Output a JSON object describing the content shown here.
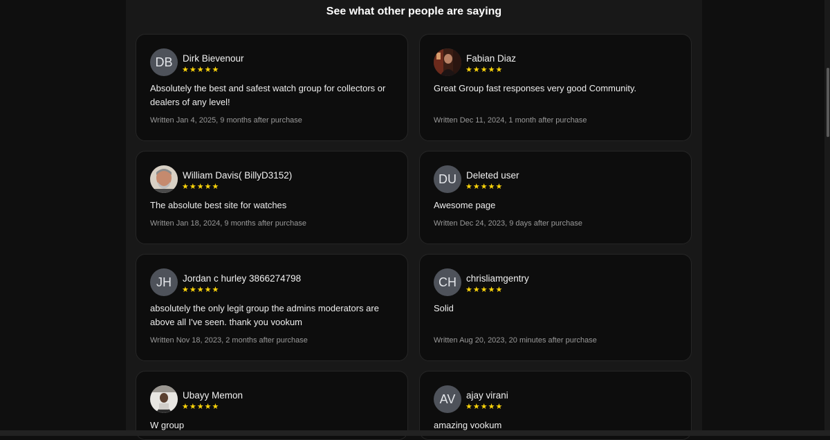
{
  "section": {
    "title": "See what other people are saying"
  },
  "colors": {
    "star": "#ffd60a",
    "avatar_bg": "#4e525a",
    "card_bg": "#0d0d0d",
    "page_bg": "#181818"
  },
  "reviews": [
    {
      "initials": "DB",
      "name": "Dirk Bievenour",
      "rating": 5,
      "text": "Absolutely the best and safest watch group for collectors or dealers of any level!",
      "meta": "Written Jan 4, 2025, 9 months after purchase"
    },
    {
      "initials": "",
      "name": "Fabian Diaz",
      "rating": 5,
      "text": "Great Group fast responses very good Community.",
      "meta": "Written Dec 11, 2024, 1 month after purchase"
    },
    {
      "initials": "",
      "name": "William Davis( BillyD3152)",
      "rating": 5,
      "text": "The absolute best site for watches",
      "meta": "Written Jan 18, 2024, 9 months after purchase"
    },
    {
      "initials": "DU",
      "name": "Deleted user",
      "rating": 5,
      "text": "Awesome page",
      "meta": "Written Dec 24, 2023, 9 days after purchase"
    },
    {
      "initials": "JH",
      "name": "Jordan c hurley 3866274798",
      "rating": 5,
      "text": "absolutely the only legit group the admins moderators are above all I've seen. thank you vookum",
      "meta": "Written Nov 18, 2023, 2 months after purchase"
    },
    {
      "initials": "CH",
      "name": "chrisliamgentry",
      "rating": 5,
      "text": "Solid",
      "meta": "Written Aug 20, 2023, 20 minutes after purchase"
    },
    {
      "initials": "",
      "name": "Ubayy Memon",
      "rating": 5,
      "text": "W group",
      "meta": ""
    },
    {
      "initials": "AV",
      "name": "ajay virani",
      "rating": 5,
      "text": "amazing vookum",
      "meta": ""
    }
  ]
}
